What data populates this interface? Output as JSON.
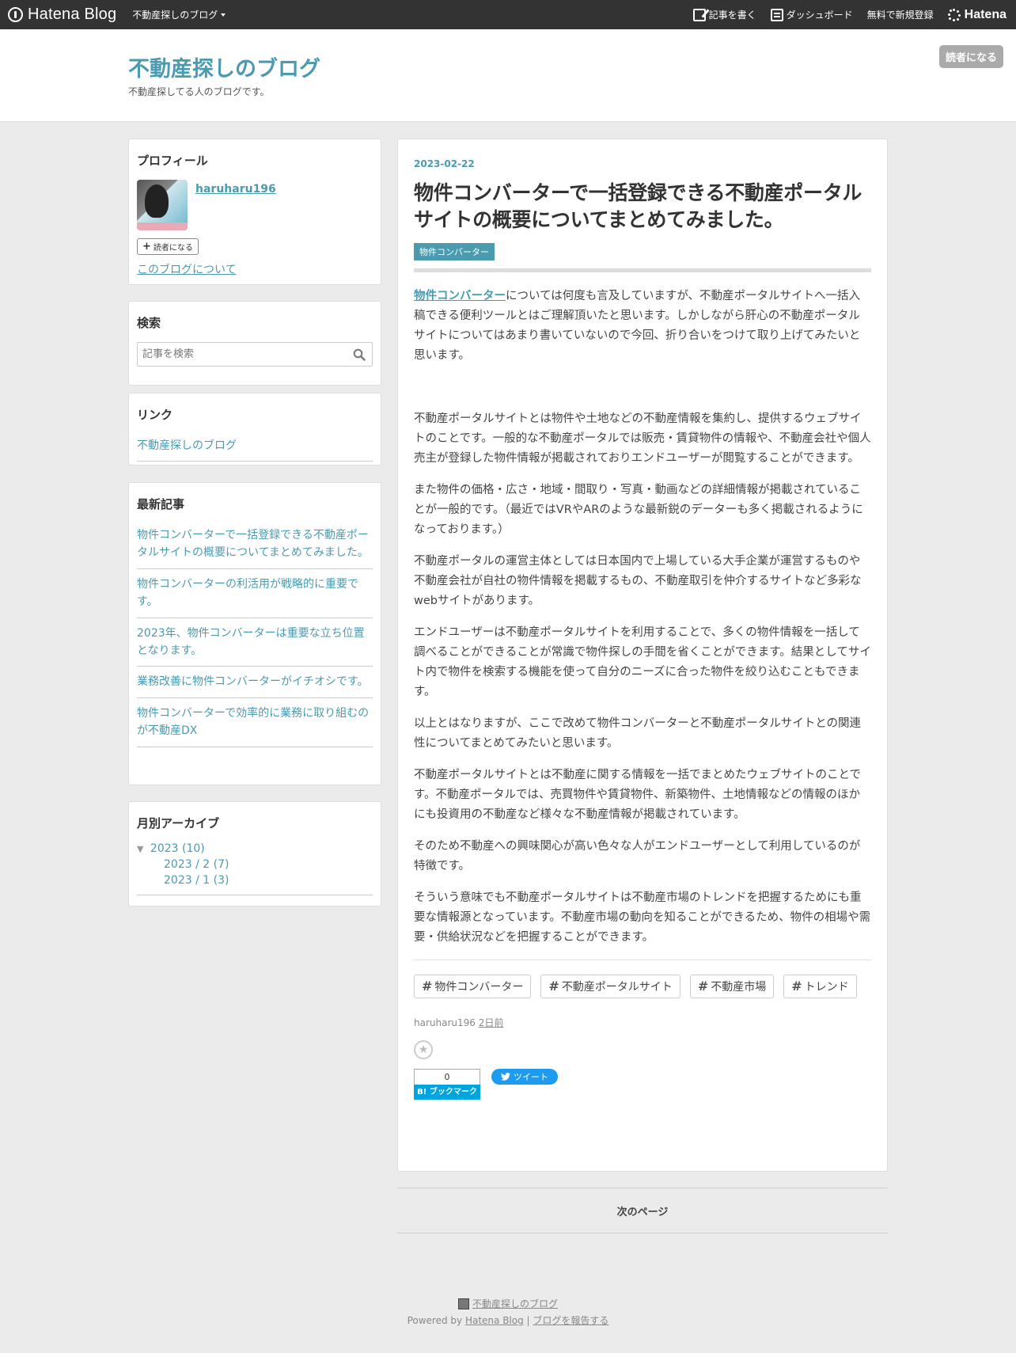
{
  "globalbar": {
    "brand": "Hatena Blog",
    "blog_menu": "不動産探しのブログ",
    "write": "記事を書く",
    "dashboard": "ダッシュボード",
    "signup": "無料で新規登録",
    "hatena": "Hatena"
  },
  "header": {
    "title": "不動産探しのブログ",
    "description": "不動産探してる人のブログです。",
    "subscribe": "読者になる"
  },
  "sidebar": {
    "profile": {
      "heading": "プロフィール",
      "name": "haruharu196",
      "follow": "読者になる",
      "about": "このブログについて"
    },
    "search": {
      "heading": "検索",
      "placeholder": "記事を検索"
    },
    "links": {
      "heading": "リンク",
      "items": [
        "不動産探しのブログ"
      ]
    },
    "recent": {
      "heading": "最新記事",
      "items": [
        "物件コンバーターで一括登録できる不動産ポータルサイトの概要についてまとめてみました。",
        "物件コンバーターの利活用が戦略的に重要です。",
        "2023年、物件コンバーターは重要な立ち位置となります。",
        "業務改善に物件コンバーターがイチオシです。",
        "物件コンバーターで効率的に業務に取り組むのが不動産DX"
      ]
    },
    "archive": {
      "heading": "月別アーカイブ",
      "year": "2023 (10)",
      "months": [
        "2023 / 2 (7)",
        "2023 / 1 (3)"
      ]
    }
  },
  "article": {
    "date": "2023-02-22",
    "title": "物件コンバーターで一括登録できる不動産ポータルサイトの概要についてまとめてみました。",
    "category": "物件コンバーター",
    "intro_keyword": "物件コンバーター",
    "intro_rest": "については何度も言及していますが、不動産ポータルサイトへ一括入稿できる便利ツールとはご理解頂いたと思います。しかしながら肝心の不動産ポータルサイトについてはあまり書いていないので今回、折り合いをつけて取り上げてみたいと思います。",
    "paragraphs": [
      "不動産ポータルサイトとは物件や土地などの不動産情報を集約し、提供するウェブサイトのことです。一般的な不動産ポータルでは販売・賃貸物件の情報や、不動産会社や個人売主が登録した物件情報が掲載されておりエンドユーザーが閲覧することができます。",
      "また物件の価格・広さ・地域・間取り・写真・動画などの詳細情報が掲載されていることが一般的です。（最近ではVRやARのような最新鋭のデーターも多く掲載されるようになっております。）",
      "不動産ポータルの運営主体としては日本国内で上場している大手企業が運営するものや不動産会社が自社の物件情報を掲載するもの、不動産取引を仲介するサイトなど多彩なwebサイトがあります。",
      "エンドユーザーは不動産ポータルサイトを利用することで、多くの物件情報を一括して調べることができることが常識で物件探しの手間を省くことができます。結果としてサイト内で物件を検索する機能を使って自分のニーズに合った物件を絞り込むこともできます。",
      "以上とはなりますが、ここで改めて物件コンバーターと不動産ポータルサイトとの関連性についてまとめてみたいと思います。",
      "不動産ポータルサイトとは不動産に関する情報を一括でまとめたウェブサイトのことです。不動産ポータルでは、売買物件や賃貸物件、新築物件、土地情報などの情報のほかにも投資用の不動産など様々な不動産情報が掲載されています。",
      "そのため不動産への興味関心が高い色々な人がエンドユーザーとして利用しているのが特徴です。",
      "そういう意味でも不動産ポータルサイトは不動産市場のトレンドを把握するためにも重要な情報源となっています。不動産市場の動向を知ることができるため、物件の相場や需要・供給状況などを把握することができます。"
    ],
    "tags": [
      "物件コンバーター",
      "不動産ポータルサイト",
      "不動産市場",
      "トレンド"
    ],
    "author": "haruharu196",
    "ago": "2日前",
    "bookmark_count": "0",
    "bookmark_label": "B! ブックマーク",
    "tweet_label": "ツイート"
  },
  "pager": {
    "next": "次のページ"
  },
  "footer": {
    "blog_name": "不動産探しのブログ",
    "powered_prefix": "Powered by",
    "powered_link": "Hatena Blog",
    "separator": "|",
    "report": "ブログを報告する"
  }
}
